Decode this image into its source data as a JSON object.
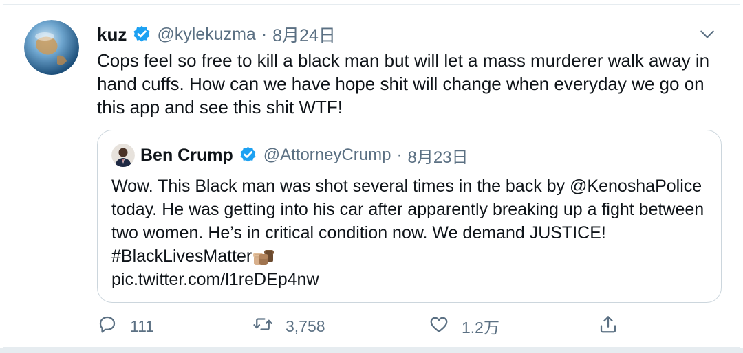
{
  "tweet": {
    "display_name": "kuz",
    "handle": "@kylekuzma",
    "separator": "·",
    "date": "8月24日",
    "text": "Cops feel so free to kill a black man but will let a mass murderer walk away in hand cuffs. How can we have hope shit will change when everyday we go on this app and see this shit WTF!"
  },
  "quoted": {
    "display_name": "Ben Crump",
    "handle": "@AttorneyCrump",
    "separator": "·",
    "date": "8月23日",
    "text": "Wow. This Black man was shot several times in the back by @KenoshaPolice today. He was getting into his car after apparently breaking up a fight between two women. He’s in critical condition now. We demand JUSTICE! #BlackLivesMatter",
    "link": "pic.twitter.com/l1reDEp4nw"
  },
  "actions": {
    "reply_count": "111",
    "retweet_count": "3,758",
    "like_count": "1.2万"
  },
  "icons": {
    "verified": "verified-badge-icon",
    "caret": "chevron-down-icon",
    "reply": "reply-icon",
    "retweet": "retweet-icon",
    "like": "heart-icon",
    "share": "share-icon"
  },
  "colors": {
    "verified_blue": "#1da1f2",
    "secondary_text": "#5b7083",
    "border": "#ccd6dd"
  }
}
